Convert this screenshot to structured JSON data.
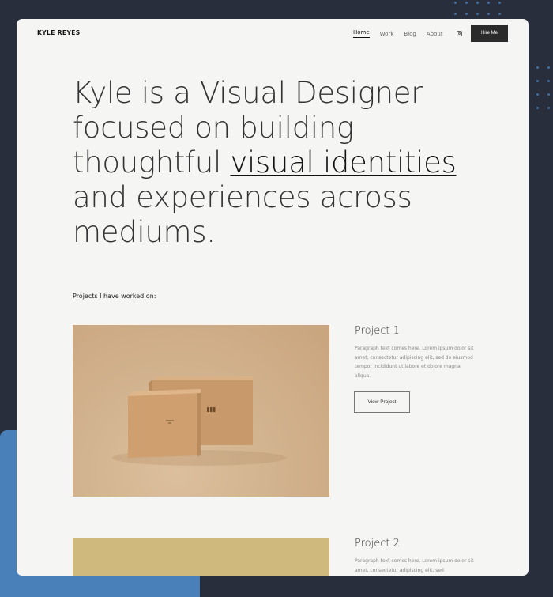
{
  "nav": {
    "logo": "KYLE REYES",
    "links": [
      "Home",
      "Work",
      "Blog",
      "About"
    ],
    "active": "Home",
    "hire_label": "Hire Me",
    "social_icon": "instagram-icon"
  },
  "hero": {
    "line1": "Kyle is a Visual Designer",
    "line2": "focused on building",
    "line3_prefix": "thoughtful ",
    "highlight": "visual identities",
    "line4": "and experiences across",
    "line5": "mediums."
  },
  "projects_label": "Projects I have worked on:",
  "projects": [
    {
      "title": "Project 1",
      "description": "Paragraph text comes here. Lorem ipsum dolor sit amet, consectetur adipiscing elit, sed do eiusmod tempor incididunt ut labore et dolore magna aliqua.",
      "button": "View Project",
      "image_color": "#d2b38f"
    },
    {
      "title": "Project 2",
      "description": "Paragraph text comes here. Lorem ipsum dolor sit amet, consectetur adipiscing elit, sed",
      "image_color": "#cfb97c"
    }
  ],
  "colors": {
    "background": "#282e3c",
    "card": "#f5f5f4",
    "accent_block": "#4a80b9",
    "button_dark": "#2b2b2b"
  }
}
